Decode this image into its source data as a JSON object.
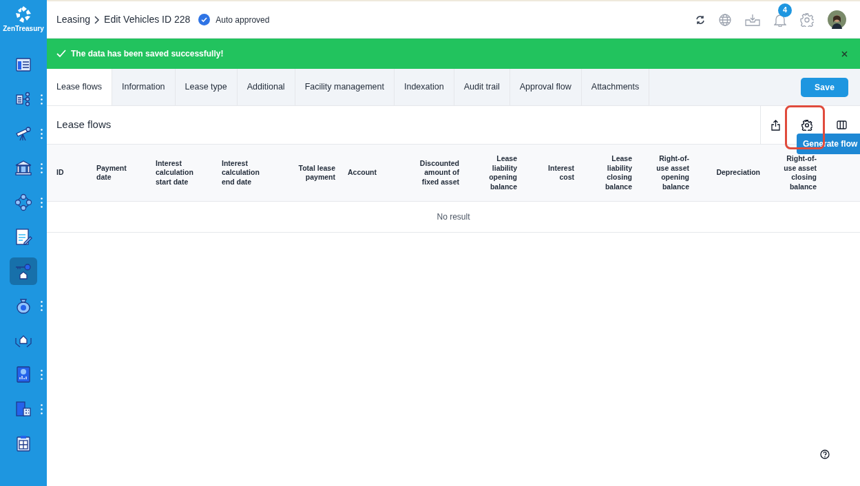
{
  "logo": {
    "name": "ZenTreasury"
  },
  "sidebar": {
    "items": [
      {
        "kind": "dashboard",
        "selected": false,
        "has_menu": false
      },
      {
        "kind": "documents",
        "selected": false,
        "has_menu": true
      },
      {
        "kind": "telescope",
        "selected": false,
        "has_menu": true
      },
      {
        "kind": "bank",
        "selected": false,
        "has_menu": true
      },
      {
        "kind": "coins",
        "selected": false,
        "has_menu": true
      },
      {
        "kind": "invoice",
        "selected": false,
        "has_menu": false
      },
      {
        "kind": "key-house",
        "selected": true,
        "has_menu": false
      },
      {
        "kind": "money-bag",
        "selected": false,
        "has_menu": true
      },
      {
        "kind": "hands-house",
        "selected": false,
        "has_menu": false
      },
      {
        "kind": "book",
        "selected": false,
        "has_menu": true
      },
      {
        "kind": "building",
        "selected": false,
        "has_menu": true
      },
      {
        "kind": "clipboard",
        "selected": false,
        "has_menu": false
      }
    ]
  },
  "header": {
    "breadcrumb": [
      "Leasing",
      "Edit Vehicles ID 228"
    ],
    "status": "Auto approved",
    "notification_count": "4"
  },
  "toast": {
    "message": "The data has been saved successfully!"
  },
  "tabs": [
    {
      "label": "Lease flows",
      "selected": true
    },
    {
      "label": "Information",
      "selected": false
    },
    {
      "label": "Lease type",
      "selected": false
    },
    {
      "label": "Additional",
      "selected": false
    },
    {
      "label": "Facility management",
      "selected": false
    },
    {
      "label": "Indexation",
      "selected": false
    },
    {
      "label": "Audit trail",
      "selected": false
    },
    {
      "label": "Approval flow",
      "selected": false
    },
    {
      "label": "Attachments",
      "selected": false
    }
  ],
  "save_button": "Save",
  "panel": {
    "title": "Lease flows",
    "tooltip": "Generate flow"
  },
  "table": {
    "columns": [
      {
        "label": "ID",
        "kind": "text"
      },
      {
        "label": "Payment date",
        "kind": "text"
      },
      {
        "label": "Interest calculation start date",
        "kind": "text"
      },
      {
        "label": "Interest calculation end date",
        "kind": "text"
      },
      {
        "label": "Total lease payment",
        "kind": "number"
      },
      {
        "label": "Account",
        "kind": "text"
      },
      {
        "label": "Discounted amount of fixed asset",
        "kind": "number"
      },
      {
        "label": "Lease liability opening balance",
        "kind": "number"
      },
      {
        "label": "Interest cost",
        "kind": "number"
      },
      {
        "label": "Lease liability closing balance",
        "kind": "number"
      },
      {
        "label": "Right-of-use asset opening balance",
        "kind": "number"
      },
      {
        "label": "Depreciation",
        "kind": "number"
      },
      {
        "label": "Right-of-use asset closing balance",
        "kind": "number"
      }
    ],
    "empty_text": "No result"
  }
}
